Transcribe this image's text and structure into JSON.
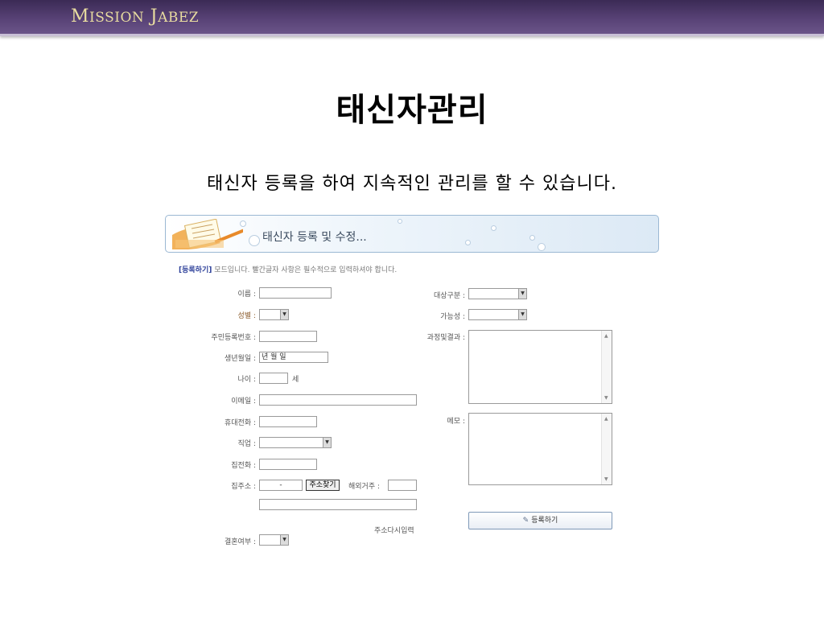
{
  "header": {
    "brand_word1_cap": "M",
    "brand_word1_rest": "ISSION",
    "brand_word2_cap": "J",
    "brand_word2_rest": "ABEZ"
  },
  "slide": {
    "title": "태신자관리",
    "subtitle": "태신자 등록을 하여 지속적인 관리를 할 수 있습니다."
  },
  "screenshot": {
    "banner_title": "태신자 등록 및 수정...",
    "notice_mode": "[등록하기]",
    "notice_text": " 모드입니다. 빨간글자 사항은 필수적으로 입력하셔야 합니다.",
    "labels": {
      "name": "이름 :",
      "gender": "성별 :",
      "resident_no": "주민등록번호 :",
      "birthday": "생년월일 :",
      "age": "나이 :",
      "email": "이메일 :",
      "mobile": "휴대전화 :",
      "job": "직업 :",
      "home_phone": "집전화 :",
      "address": "집주소 :",
      "overseas": "해외거주 :",
      "marital": "결혼여부 :",
      "target_type": "대상구분 :",
      "possibility": "가능성 :",
      "process_result": "과정및결과 :",
      "memo": "메모 :"
    },
    "values": {
      "birthday": "년  월  일",
      "zip": "-"
    },
    "age_unit": "세",
    "find_address_button": "주소찾기",
    "reenter_address_link": "주소다시입력",
    "register_button": "등록하기"
  }
}
